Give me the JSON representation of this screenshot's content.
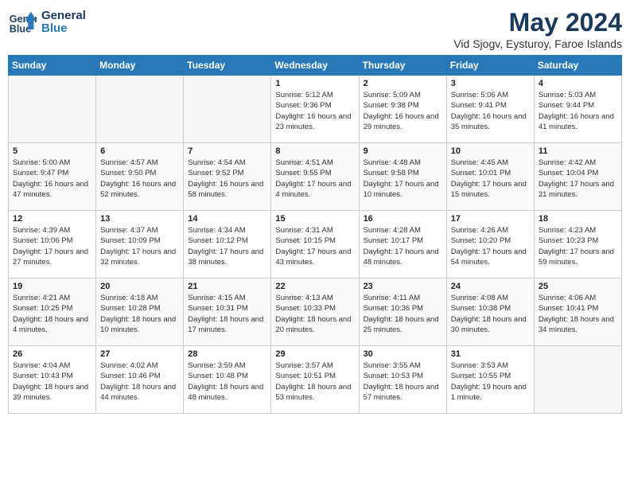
{
  "header": {
    "logo_line1": "General",
    "logo_line2": "Blue",
    "month_year": "May 2024",
    "location": "Vid Sjogv, Eysturoy, Faroe Islands"
  },
  "days_of_week": [
    "Sunday",
    "Monday",
    "Tuesday",
    "Wednesday",
    "Thursday",
    "Friday",
    "Saturday"
  ],
  "weeks": [
    [
      {
        "num": "",
        "empty": true
      },
      {
        "num": "",
        "empty": true
      },
      {
        "num": "",
        "empty": true
      },
      {
        "num": "1",
        "sunrise": "5:12 AM",
        "sunset": "9:36 PM",
        "daylight": "16 hours and 23 minutes."
      },
      {
        "num": "2",
        "sunrise": "5:09 AM",
        "sunset": "9:38 PM",
        "daylight": "16 hours and 29 minutes."
      },
      {
        "num": "3",
        "sunrise": "5:06 AM",
        "sunset": "9:41 PM",
        "daylight": "16 hours and 35 minutes."
      },
      {
        "num": "4",
        "sunrise": "5:03 AM",
        "sunset": "9:44 PM",
        "daylight": "16 hours and 41 minutes."
      }
    ],
    [
      {
        "num": "5",
        "sunrise": "5:00 AM",
        "sunset": "9:47 PM",
        "daylight": "16 hours and 47 minutes."
      },
      {
        "num": "6",
        "sunrise": "4:57 AM",
        "sunset": "9:50 PM",
        "daylight": "16 hours and 52 minutes."
      },
      {
        "num": "7",
        "sunrise": "4:54 AM",
        "sunset": "9:52 PM",
        "daylight": "16 hours and 58 minutes."
      },
      {
        "num": "8",
        "sunrise": "4:51 AM",
        "sunset": "9:55 PM",
        "daylight": "17 hours and 4 minutes."
      },
      {
        "num": "9",
        "sunrise": "4:48 AM",
        "sunset": "9:58 PM",
        "daylight": "17 hours and 10 minutes."
      },
      {
        "num": "10",
        "sunrise": "4:45 AM",
        "sunset": "10:01 PM",
        "daylight": "17 hours and 15 minutes."
      },
      {
        "num": "11",
        "sunrise": "4:42 AM",
        "sunset": "10:04 PM",
        "daylight": "17 hours and 21 minutes."
      }
    ],
    [
      {
        "num": "12",
        "sunrise": "4:39 AM",
        "sunset": "10:06 PM",
        "daylight": "17 hours and 27 minutes."
      },
      {
        "num": "13",
        "sunrise": "4:37 AM",
        "sunset": "10:09 PM",
        "daylight": "17 hours and 32 minutes."
      },
      {
        "num": "14",
        "sunrise": "4:34 AM",
        "sunset": "10:12 PM",
        "daylight": "17 hours and 38 minutes."
      },
      {
        "num": "15",
        "sunrise": "4:31 AM",
        "sunset": "10:15 PM",
        "daylight": "17 hours and 43 minutes."
      },
      {
        "num": "16",
        "sunrise": "4:28 AM",
        "sunset": "10:17 PM",
        "daylight": "17 hours and 48 minutes."
      },
      {
        "num": "17",
        "sunrise": "4:26 AM",
        "sunset": "10:20 PM",
        "daylight": "17 hours and 54 minutes."
      },
      {
        "num": "18",
        "sunrise": "4:23 AM",
        "sunset": "10:23 PM",
        "daylight": "17 hours and 59 minutes."
      }
    ],
    [
      {
        "num": "19",
        "sunrise": "4:21 AM",
        "sunset": "10:25 PM",
        "daylight": "18 hours and 4 minutes."
      },
      {
        "num": "20",
        "sunrise": "4:18 AM",
        "sunset": "10:28 PM",
        "daylight": "18 hours and 10 minutes."
      },
      {
        "num": "21",
        "sunrise": "4:15 AM",
        "sunset": "10:31 PM",
        "daylight": "18 hours and 17 minutes."
      },
      {
        "num": "22",
        "sunrise": "4:13 AM",
        "sunset": "10:33 PM",
        "daylight": "18 hours and 20 minutes."
      },
      {
        "num": "23",
        "sunrise": "4:11 AM",
        "sunset": "10:36 PM",
        "daylight": "18 hours and 25 minutes."
      },
      {
        "num": "24",
        "sunrise": "4:08 AM",
        "sunset": "10:38 PM",
        "daylight": "18 hours and 30 minutes."
      },
      {
        "num": "25",
        "sunrise": "4:06 AM",
        "sunset": "10:41 PM",
        "daylight": "18 hours and 34 minutes."
      }
    ],
    [
      {
        "num": "26",
        "sunrise": "4:04 AM",
        "sunset": "10:43 PM",
        "daylight": "18 hours and 39 minutes."
      },
      {
        "num": "27",
        "sunrise": "4:02 AM",
        "sunset": "10:46 PM",
        "daylight": "18 hours and 44 minutes."
      },
      {
        "num": "28",
        "sunrise": "3:59 AM",
        "sunset": "10:48 PM",
        "daylight": "18 hours and 48 minutes."
      },
      {
        "num": "29",
        "sunrise": "3:57 AM",
        "sunset": "10:51 PM",
        "daylight": "18 hours and 53 minutes."
      },
      {
        "num": "30",
        "sunrise": "3:55 AM",
        "sunset": "10:53 PM",
        "daylight": "18 hours and 57 minutes."
      },
      {
        "num": "31",
        "sunrise": "3:53 AM",
        "sunset": "10:55 PM",
        "daylight": "19 hours and 1 minute."
      },
      {
        "num": "",
        "empty": true
      }
    ]
  ]
}
